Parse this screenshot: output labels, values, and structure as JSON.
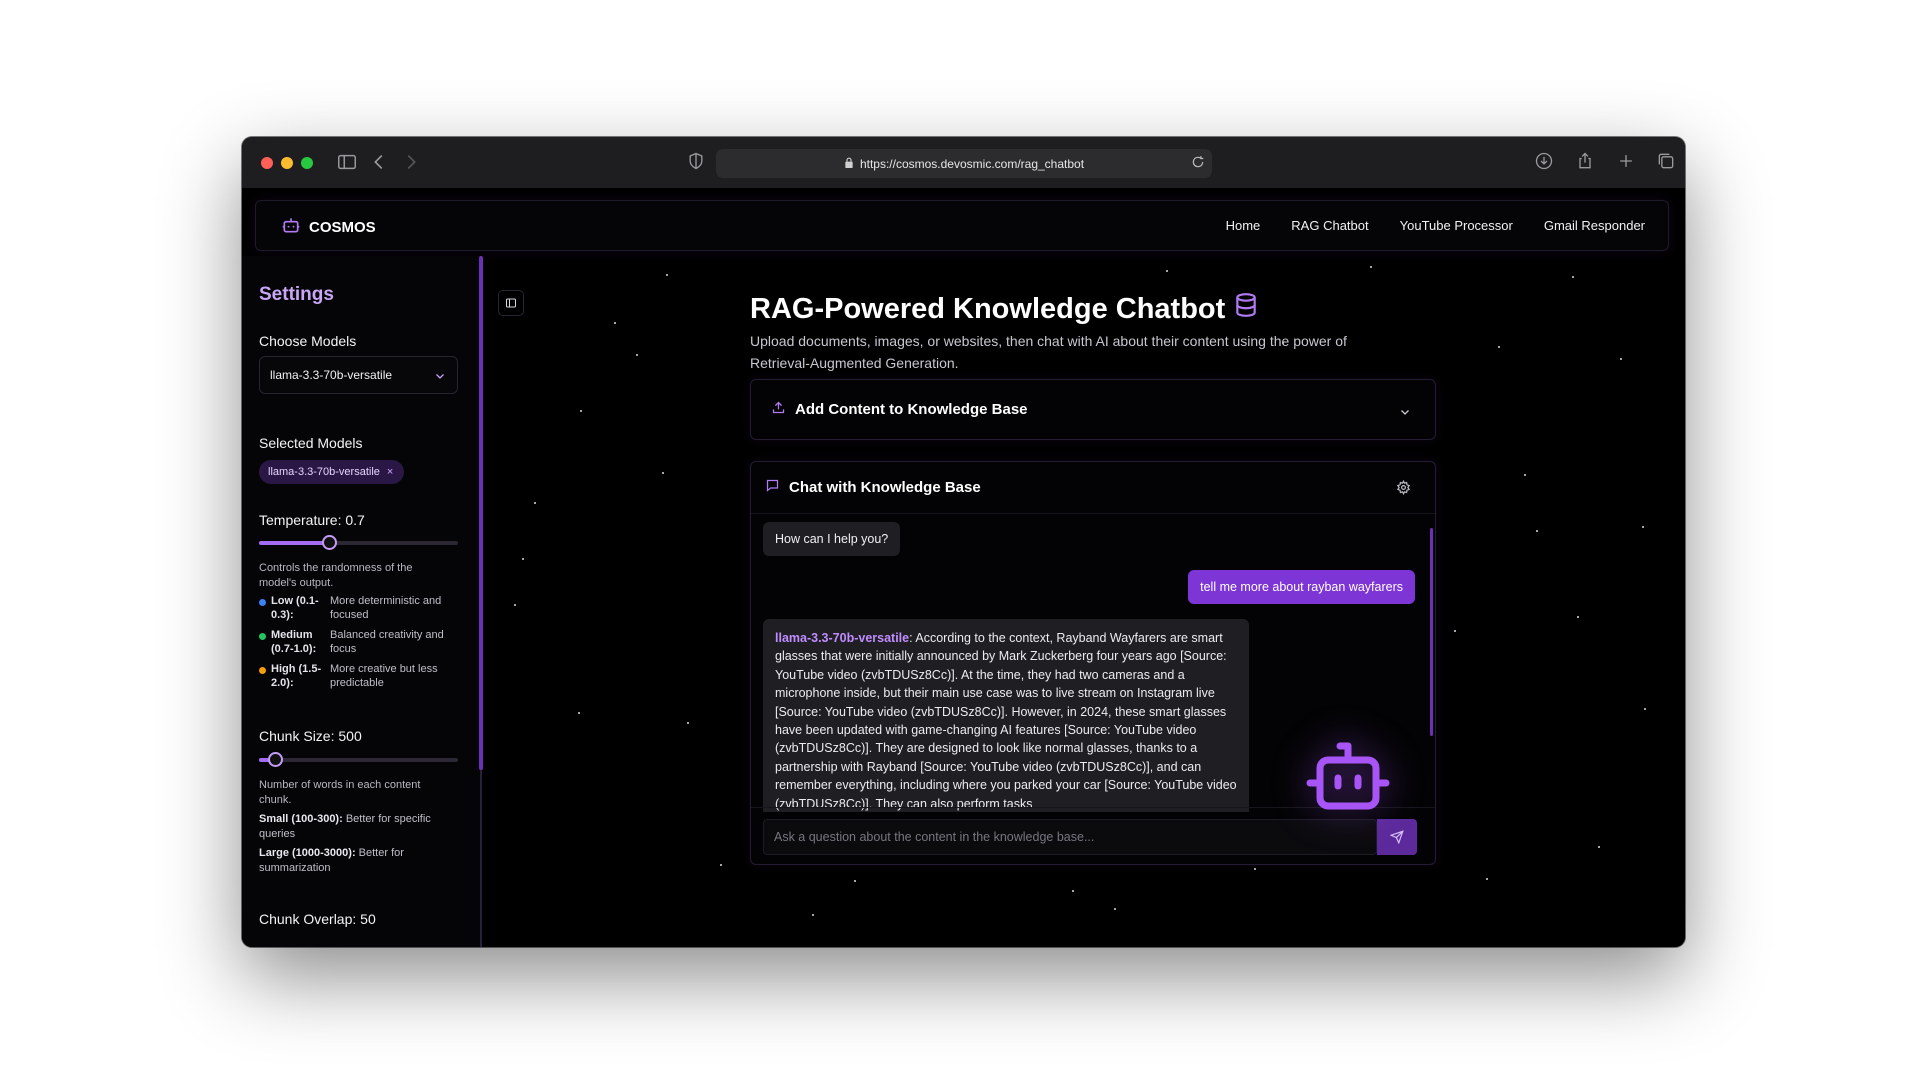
{
  "browser": {
    "url": "https://cosmos.devosmic.com/rag_chatbot"
  },
  "navbar": {
    "brand": "COSMOS",
    "links": [
      "Home",
      "RAG Chatbot",
      "YouTube Processor",
      "Gmail Responder"
    ]
  },
  "sidebar": {
    "title": "Settings",
    "choose_models_label": "Choose Models",
    "model_select_value": "llama-3.3-70b-versatile",
    "selected_models_label": "Selected Models",
    "selected_models": [
      "llama-3.3-70b-versatile"
    ],
    "chip_remove": "×",
    "temperature": {
      "label": "Temperature: 0.7",
      "value": 0.7,
      "min": 0,
      "max": 2,
      "help": "Controls the randomness of the model's output.",
      "legend": [
        {
          "key": "Low (0.1-0.3):",
          "desc": "More deterministic and focused",
          "color": "#3b82f6"
        },
        {
          "key": "Medium (0.7-1.0):",
          "desc": "Balanced creativity and focus",
          "color": "#22c55e"
        },
        {
          "key": "High (1.5-2.0):",
          "desc": "More creative but less predictable",
          "color": "#f59e0b"
        }
      ]
    },
    "chunk_size": {
      "label": "Chunk Size: 500",
      "value": 500,
      "min": 100,
      "max": 5000,
      "help": "Number of words in each content chunk.",
      "small_key": "Small (100-300):",
      "small_desc": "Better for specific queries",
      "large_key": "Large (1000-3000):",
      "large_desc": "Better for summarization"
    },
    "chunk_overlap": {
      "label": "Chunk Overlap: 50"
    }
  },
  "main": {
    "title": "RAG-Powered Knowledge Chatbot",
    "subtitle": "Upload documents, images, or websites, then chat with AI about their content using the power of Retrieval-Augmented Generation.",
    "add_content": "Add Content to Knowledge Base",
    "chat_title": "Chat with Knowledge Base",
    "messages": {
      "greeting": "How can I help you?",
      "user": "tell me more about rayban wayfarers",
      "answer_model": "llama-3.3-70b-versatile",
      "answer_text": ": According to the context, Rayband Wayfarers are smart glasses that were initially announced by Mark Zuckerberg four years ago [Source: YouTube video (zvbTDUSz8Cc)]. At the time, they had two cameras and a microphone inside, but their main use case was to live stream on Instagram live [Source: YouTube video (zvbTDUSz8Cc)]. However, in 2024, these smart glasses have been updated with game-changing AI features [Source: YouTube video (zvbTDUSz8Cc)]. They are designed to look like normal glasses, thanks to a partnership with Rayband [Source: YouTube video (zvbTDUSz8Cc)], and can remember everything, including where you parked your car [Source: YouTube video (zvbTDUSz8Cc)]. They can also perform tasks"
    },
    "input_placeholder": "Ask a question about the content in the knowledge base..."
  },
  "colors": {
    "accent": "#a855f7",
    "user_bubble": "#7d35d6",
    "background": "#000000"
  }
}
